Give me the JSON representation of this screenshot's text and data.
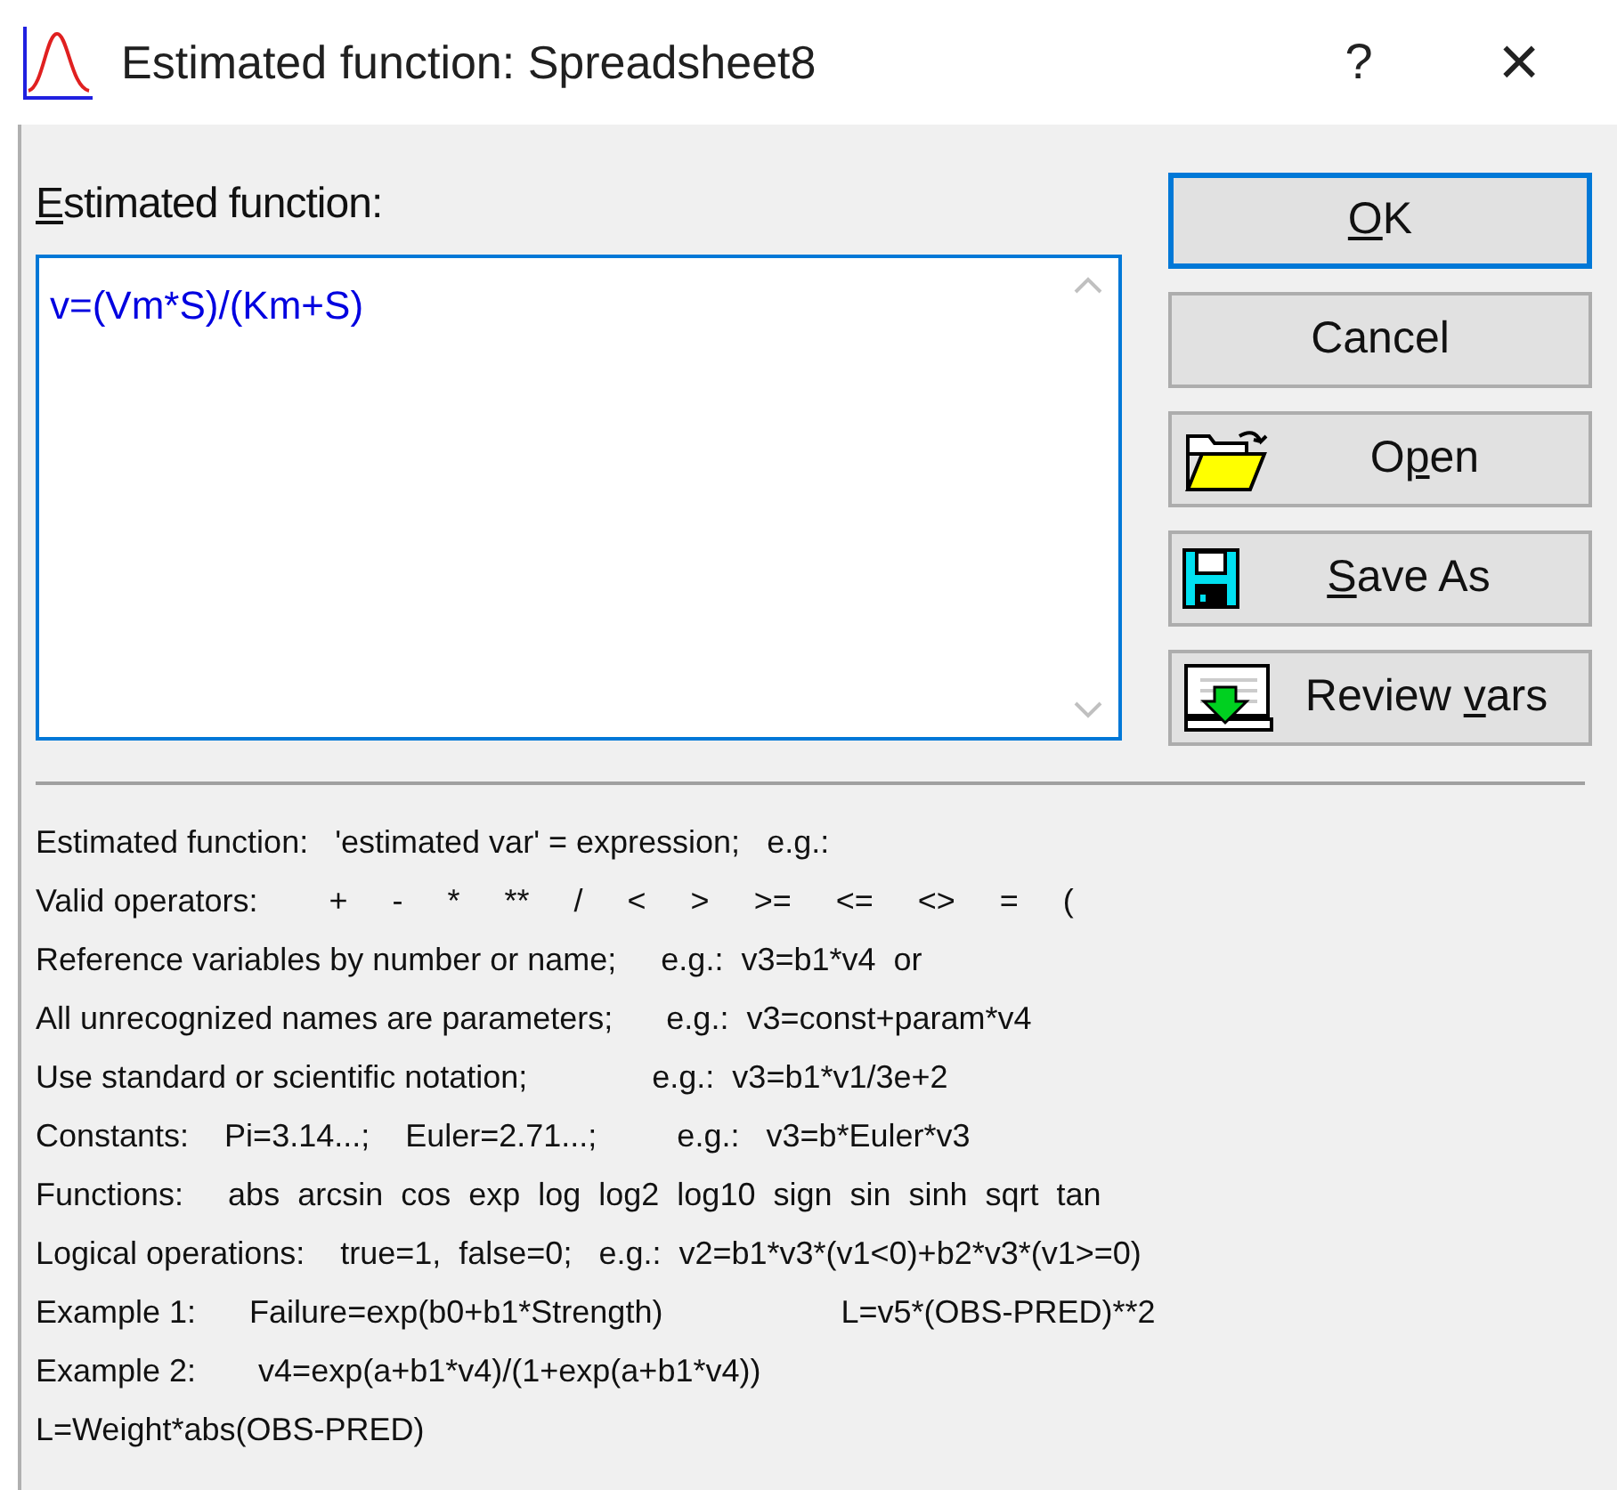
{
  "window": {
    "title": "Estimated function: Spreadsheet8",
    "help_glyph": "?",
    "close_glyph": "×"
  },
  "editor": {
    "label": {
      "key": "E",
      "post": "stimated function:"
    },
    "value": "v=(Vm*S)/(Km+S)",
    "focused": true
  },
  "buttons": [
    {
      "kind": "text",
      "key": "O",
      "post": "K",
      "default": true
    },
    {
      "kind": "text",
      "pre": "Cancel",
      "default": false
    },
    {
      "kind": "open",
      "pre": "O",
      "key": "p",
      "post": "en",
      "default": false
    },
    {
      "kind": "save",
      "key": "S",
      "post": "ave As",
      "default": false
    },
    {
      "kind": "review",
      "pre": "Review ",
      "key": "v",
      "post": "ars",
      "default": false
    }
  ],
  "help_lines": [
    "Estimated function:   'estimated var' = expression;   e.g.:",
    "Valid operators:        +     -     *     **     /     <     >     >=     <=     <>     =     (",
    "Reference variables by number or name;     e.g.:  v3=b1*v4  or",
    "All unrecognized names are parameters;      e.g.:  v3=const+param*v4",
    "Use standard or scientific notation;              e.g.:  v3=b1*v1/3e+2",
    "Constants:    Pi=3.14...;    Euler=2.71...;         e.g.:   v3=b*Euler*v3",
    "Functions:     abs  arcsin  cos  exp  log  log2  log10  sign  sin  sinh  sqrt  tan",
    "Logical operations:    true=1,  false=0;   e.g.:  v2=b1*v3*(v1<0)+b2*v3*(v1>=0)",
    "Example 1:      Failure=exp(b0+b1*Strength)                    L=v5*(OBS-PRED)**2",
    "Example 2:       v4=exp(a+b1*v4)/(1+exp(a+b1*v4))",
    "L=Weight*abs(OBS-PRED)"
  ]
}
